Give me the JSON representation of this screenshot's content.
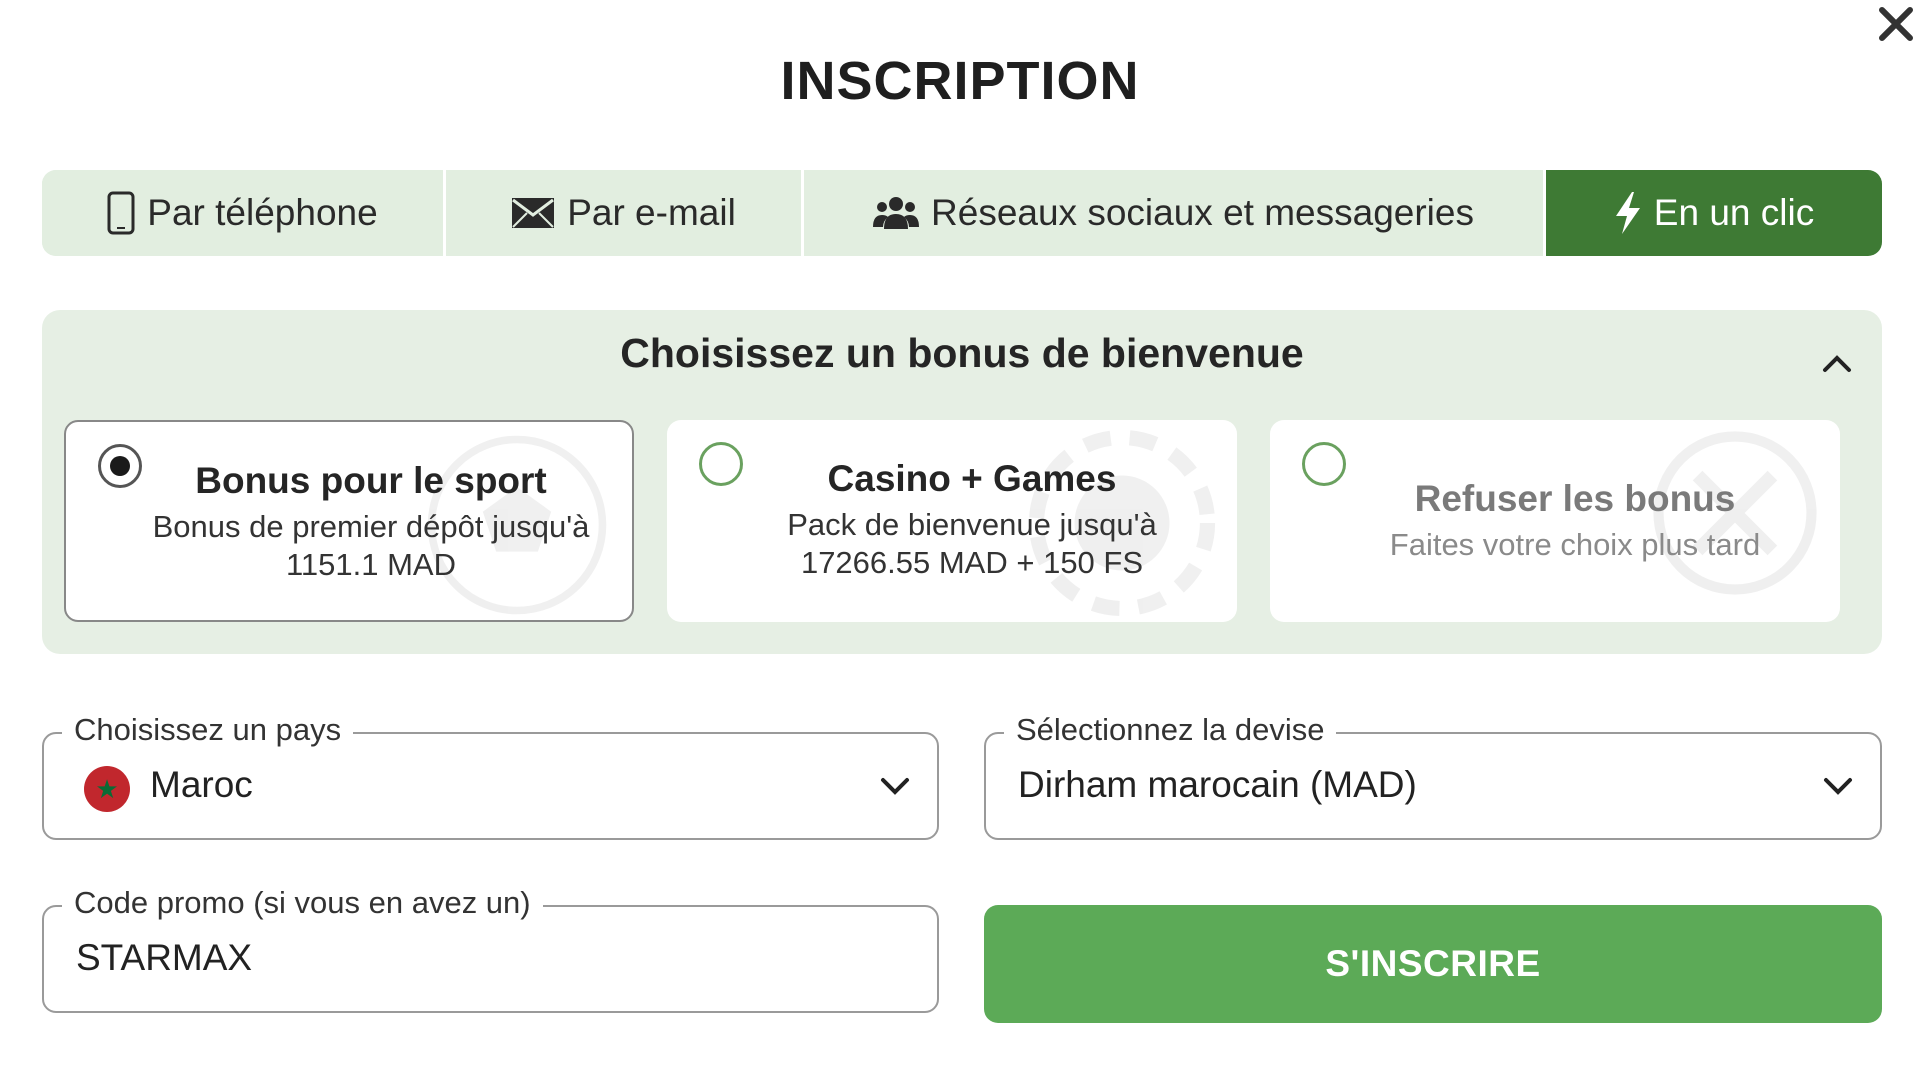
{
  "modal": {
    "title": "INSCRIPTION",
    "close_icon": "close-icon"
  },
  "tabs": [
    {
      "label": "Par téléphone",
      "icon": "phone-icon",
      "active": false
    },
    {
      "label": "Par e-mail",
      "icon": "envelope-icon",
      "active": false
    },
    {
      "label": "Réseaux sociaux et messageries",
      "icon": "users-icon",
      "active": false
    },
    {
      "label": "En un clic",
      "icon": "bolt-icon",
      "active": true
    }
  ],
  "bonus": {
    "title": "Choisissez un bonus de bienvenue",
    "collapse_icon": "chevron-up-icon",
    "options": [
      {
        "title": "Bonus pour le sport",
        "line1": "Bonus de premier dépôt jusqu'à",
        "line2": "1151.1 MAD",
        "selected": true
      },
      {
        "title": "Casino + Games",
        "line1": "Pack de bienvenue jusqu'à",
        "line2": "17266.55 MAD + 150 FS",
        "selected": false
      },
      {
        "title": "Refuser les bonus",
        "line1": "Faites votre choix plus tard",
        "selected": false
      }
    ]
  },
  "form": {
    "country": {
      "label": "Choisissez un pays",
      "value": "Maroc",
      "flag": "morocco-flag-icon"
    },
    "currency": {
      "label": "Sélectionnez la devise",
      "value": "Dirham marocain (MAD)"
    },
    "promo": {
      "label": "Code promo (si vous en avez un)",
      "value": "STARMAX"
    },
    "submit_label": "S'INSCRIRE"
  },
  "colors": {
    "accent_dark": "#3e7a34",
    "accent": "#5caa57",
    "tab_bg": "#e2eee0",
    "panel_bg": "#e6efe4"
  }
}
